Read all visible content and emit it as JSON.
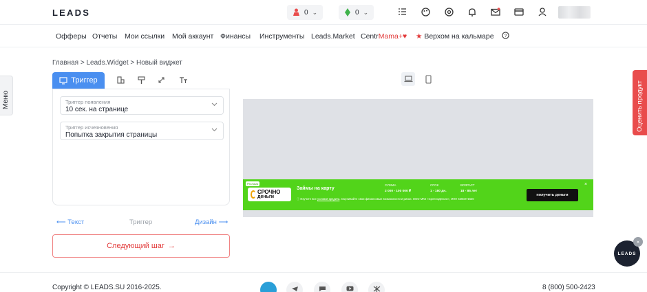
{
  "header": {
    "logo": "LEADS",
    "counters": [
      {
        "icon": "user-icon",
        "value": "0"
      },
      {
        "icon": "leaf-icon",
        "value": "0"
      }
    ],
    "icons": [
      "tasks-icon",
      "palette-icon",
      "support-icon",
      "bell-icon",
      "mail-icon",
      "card-icon",
      "profile-icon"
    ]
  },
  "nav": {
    "items": [
      "Офферы",
      "Отчеты",
      "Мои ссылки",
      "Мой аккаунт",
      "Финансы",
      "Инструменты",
      "Leads.Market"
    ],
    "centr_prefix": "Centr",
    "centr_suffix": "Mama+",
    "promo": "Верхом на кальмаре"
  },
  "breadcrumb": "Главная > Leads.Widget > Новый виджет",
  "side": {
    "menu": "Меню",
    "rate": "Оценить продукт"
  },
  "editor": {
    "active_tab": "Триггер",
    "fields": [
      {
        "label": "Триггер появления",
        "value": "10 сек. на странице"
      },
      {
        "label": "Триггер исчезновения",
        "value": "Попытка закрытия страницы"
      }
    ],
    "step_prev": "Текст",
    "step_current": "Триггер",
    "step_next": "Дизайн",
    "next_button": "Следующий шаг"
  },
  "banner": {
    "tag": "Реклама",
    "brand_line1": "СРОЧНО",
    "brand_line2": "деньги",
    "title": "Займы на карту",
    "note_prefix": "Изучите все",
    "note_link": "условия кредита",
    "note_rest": ". Оценивайте свои финансовые возможности и риски. ООО МКК «СрочноДеньги», ИНН 5260271530",
    "sum_label": "СУММА",
    "sum_value": "2 000 - 100 000 ₽",
    "term_label": "СРОК",
    "term_value": "1 - 180 дн.",
    "age_label": "ВОЗРАСТ",
    "age_value": "18 - 85 лет",
    "button": "получить деньги",
    "close": "×"
  },
  "float_logo": "LEADS",
  "footer": {
    "copyright": "Copyright © LEADS.SU 2016-2025.",
    "phone": "8 (800) 500-2423"
  },
  "colors": {
    "accent": "#4a8ff0",
    "danger": "#e23a3a",
    "banner_green": "#52d41a"
  }
}
